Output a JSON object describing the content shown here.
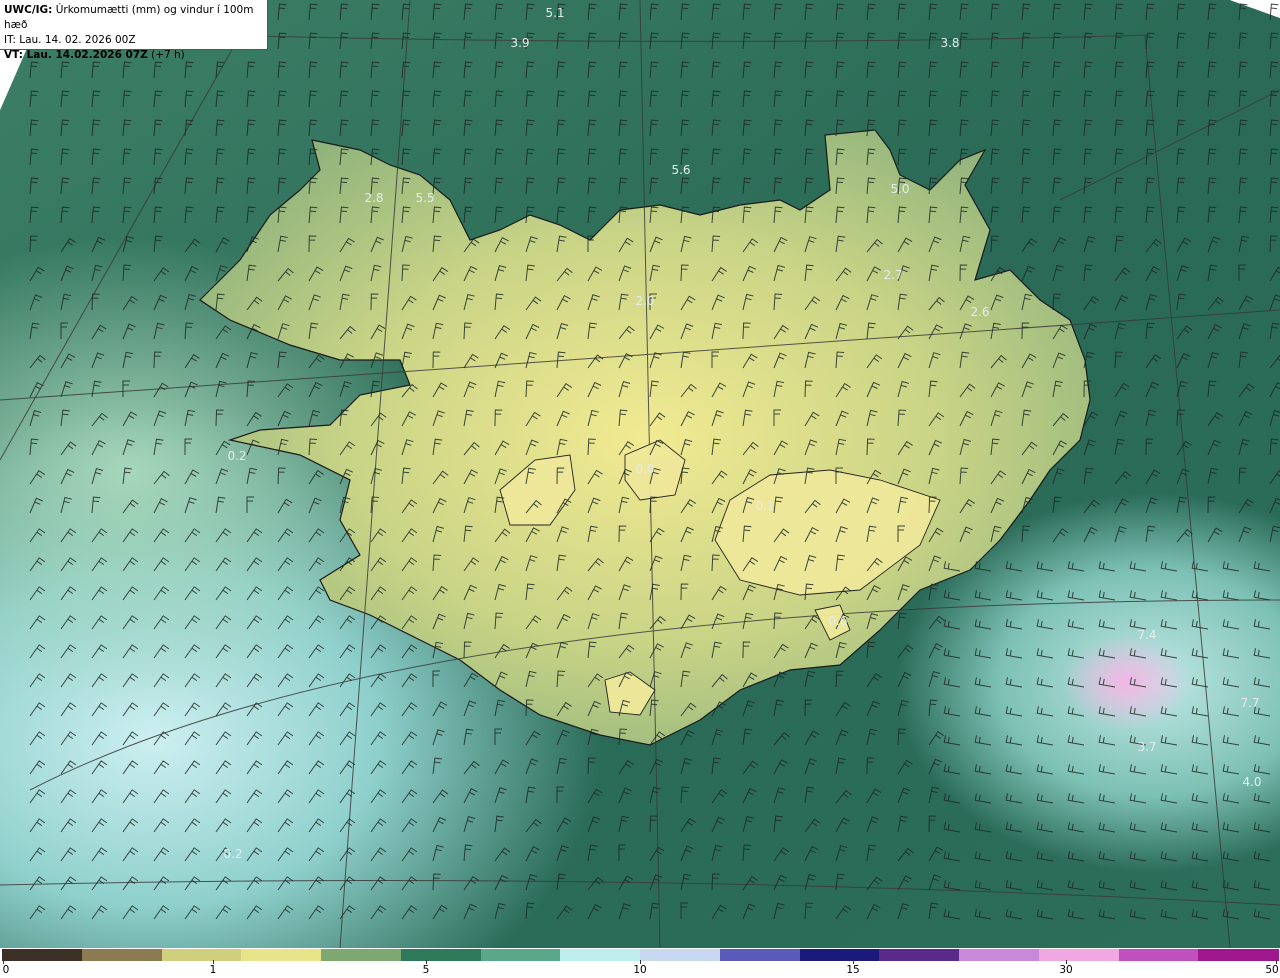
{
  "header": {
    "model": "UWC/IG:",
    "title": "Úrkomumætti (mm) og vindur í 100m hæð",
    "init_time": "IT: Lau. 14. 02. 2026 00Z",
    "valid_prefix": "VT: ",
    "valid_bold": "Lau. 14.02.2026 07Z",
    "valid_suffix": " (+7 h)"
  },
  "colorbar": {
    "tick_labels": [
      "0",
      "1",
      "5",
      "10",
      "15",
      "30",
      "50"
    ],
    "tick_values": [
      0,
      1,
      5,
      10,
      15,
      30,
      50
    ],
    "colors": [
      "#3b2f26",
      "#8b7a52",
      "#cfcf7e",
      "#e8e48a",
      "#7ea872",
      "#2f7a5a",
      "#5aa88a",
      "#bfeeee",
      "#c8d8f0",
      "#5a5ab8",
      "#1a1a7a",
      "#5a2a8a",
      "#c88ad8",
      "#f0a8e0",
      "#c050c0",
      "#a01890"
    ]
  },
  "value_labels": [
    "5.1",
    "3.9",
    "3.8",
    "5.6",
    "5.5",
    "2.8",
    "5.0",
    "2.7",
    "2.6",
    "0.2",
    "0.0",
    "0.1",
    "0.6",
    "0.2",
    "7.4",
    "7.7",
    "3.7",
    "4.0",
    "2.0"
  ],
  "map": {
    "sea_color": "#2e6e5c",
    "land_color": "#d8dc8a",
    "gridline_color": "#3a3a3a",
    "coastline_color": "#1a1a1a"
  }
}
